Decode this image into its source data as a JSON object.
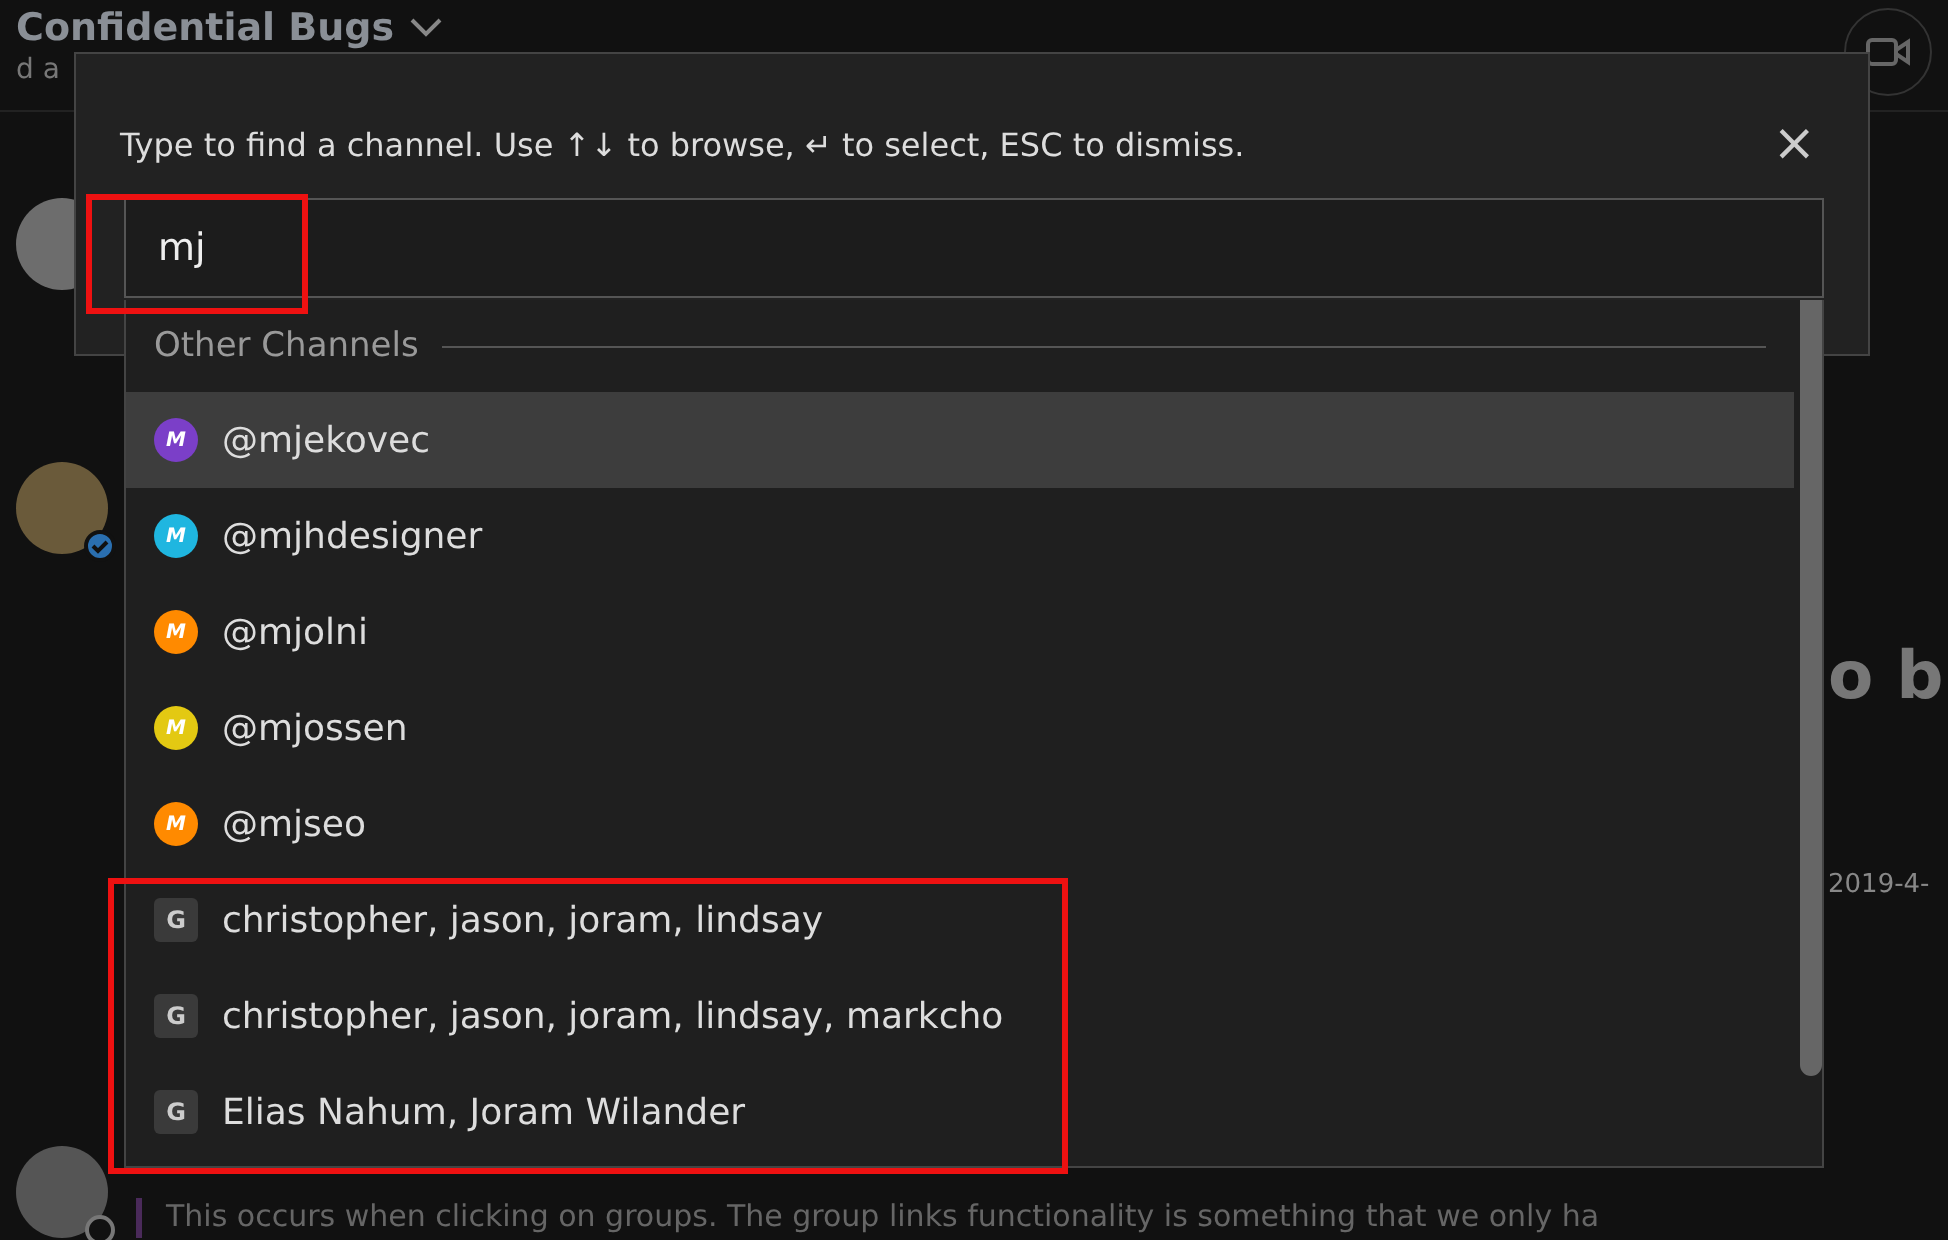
{
  "channel_header": {
    "title": "Confidential Bugs",
    "purpose": "d a"
  },
  "post_peek": {
    "heading": "o b",
    "date": "2019-4-"
  },
  "last_message": {
    "text": "This occurs when clicking on groups. The group links functionality is something that we only ha"
  },
  "switcher": {
    "hint": "Type to find a channel. Use ↑↓ to browse, ↵ to select, ESC to dismiss.",
    "close": "×",
    "query": "mj",
    "section": "Other Channels",
    "items": [
      {
        "kind": "user",
        "label": "@mjekovec",
        "initial": "M",
        "color": "#7b3fc8",
        "selected": true
      },
      {
        "kind": "user",
        "label": "@mjhdesigner",
        "initial": "M",
        "color": "#1fb6e0",
        "selected": false
      },
      {
        "kind": "user",
        "label": "@mjolni",
        "initial": "M",
        "color": "#ff8a00",
        "selected": false
      },
      {
        "kind": "user",
        "label": "@mjossen",
        "initial": "M",
        "color": "#e3c912",
        "selected": false
      },
      {
        "kind": "user",
        "label": "@mjseo",
        "initial": "M",
        "color": "#ff8a00",
        "selected": false
      },
      {
        "kind": "group",
        "label": "christopher, jason, joram, lindsay",
        "initial": "G",
        "selected": false
      },
      {
        "kind": "group",
        "label": "christopher, jason, joram, lindsay, markcho",
        "initial": "G",
        "selected": false
      },
      {
        "kind": "group",
        "label": "Elias Nahum, Joram Wilander",
        "initial": "G",
        "selected": false
      }
    ]
  }
}
